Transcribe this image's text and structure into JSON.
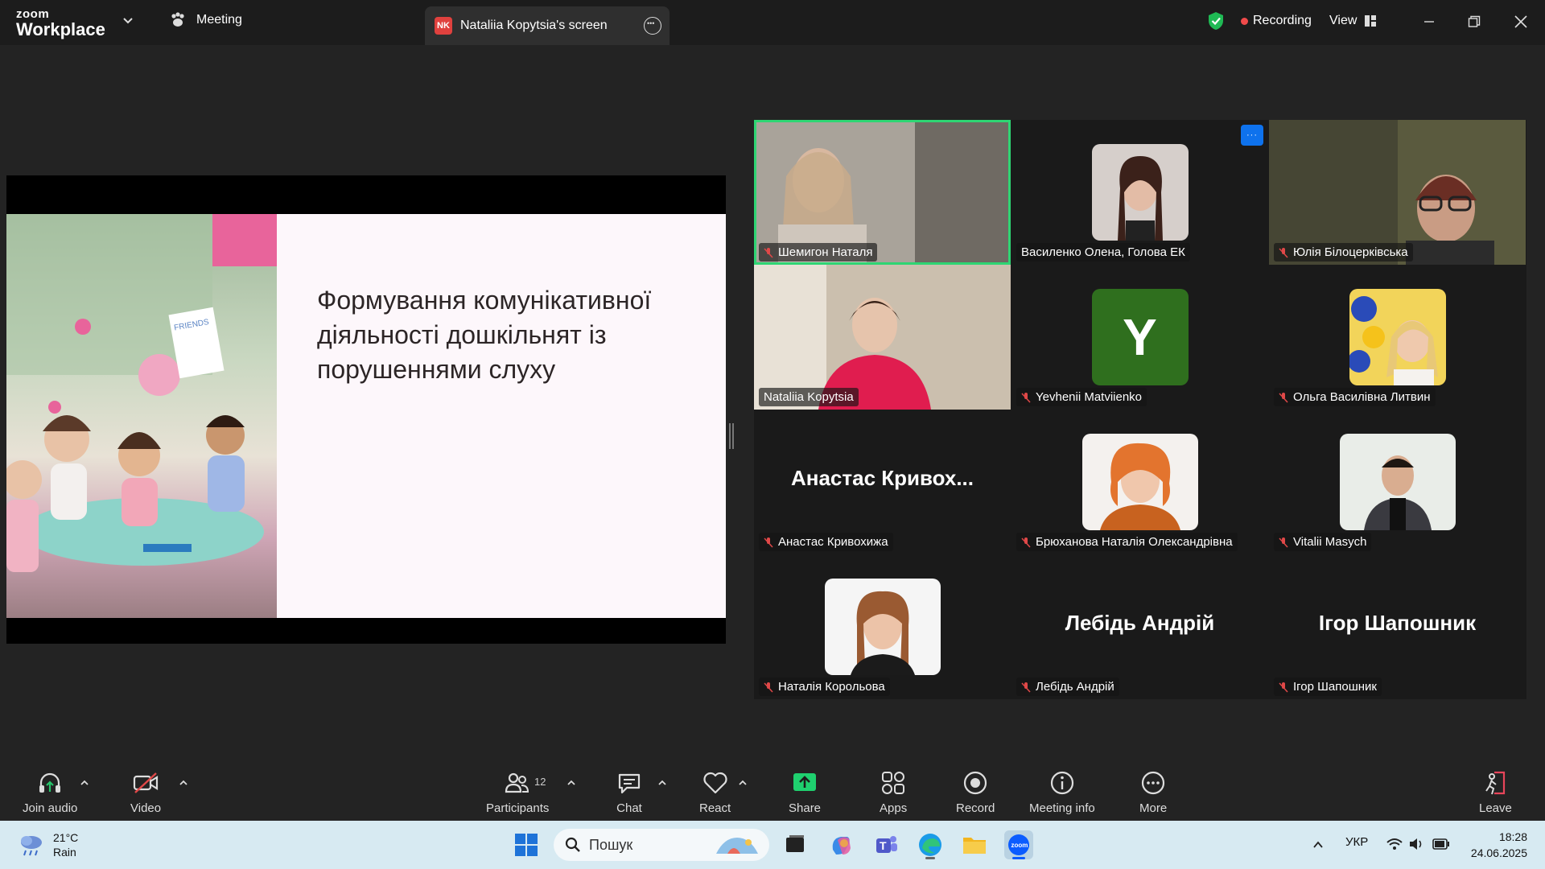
{
  "titlebar": {
    "brand_small": "zoom",
    "brand_big": "Workplace",
    "meeting_tab": "Meeting",
    "screen_tab": {
      "badge": "NK",
      "label": "Nataliia Kopytsia's screen"
    },
    "recording_label": "Recording",
    "view_label": "View"
  },
  "slide": {
    "title": "Формування комунікативної діяльності дошкільнят із порушеннями слуху",
    "photo_sign": "FRIENDS"
  },
  "gallery": {
    "tiles": [
      {
        "name": "Шемигон Наталя",
        "type": "video",
        "muted": true,
        "active": true
      },
      {
        "name": "Василенко Олена, Голова ЕК",
        "type": "photo",
        "muted": false
      },
      {
        "name": "Юлія Білоцерківська",
        "type": "video",
        "muted": true
      },
      {
        "name": "Nataliia Kopytsia",
        "type": "video",
        "muted": false
      },
      {
        "name": "Yevhenii Matviienko",
        "type": "initial",
        "initial": "Y",
        "muted": true
      },
      {
        "name": "Ольга Василівна Литвин",
        "type": "photo",
        "muted": true
      },
      {
        "name": "Анастас Кривохижа",
        "type": "text",
        "bigname": "Анастас  Кривох...",
        "muted": true
      },
      {
        "name": "Брюханова Наталія Олександрівна",
        "type": "photo",
        "muted": true
      },
      {
        "name": "Vitalii Masych",
        "type": "photo",
        "muted": true
      },
      {
        "name": "Наталія Корольова",
        "type": "photo",
        "muted": true
      },
      {
        "name": "Лебідь Андрій",
        "type": "text",
        "bigname": "Лебідь Андрій",
        "muted": true
      },
      {
        "name": "Ігор Шапошник",
        "type": "text",
        "bigname": "Ігор Шапошник",
        "muted": true
      }
    ],
    "more_label": "···"
  },
  "toolbar": {
    "join_audio": "Join audio",
    "video": "Video",
    "participants": "Participants",
    "participants_count": "12",
    "chat": "Chat",
    "react": "React",
    "share": "Share",
    "apps": "Apps",
    "record": "Record",
    "meeting_info": "Meeting info",
    "more": "More",
    "leave": "Leave"
  },
  "taskbar": {
    "weather_temp": "21°C",
    "weather_desc": "Rain",
    "search_placeholder": "Пошук",
    "lang": "УКР",
    "time": "18:28",
    "date": "24.06.2025"
  },
  "colors": {
    "accent_green": "#2ed573",
    "zoom_blue": "#0e72ed",
    "share_green": "#1fd06f",
    "recording_red": "#f04a4a"
  }
}
